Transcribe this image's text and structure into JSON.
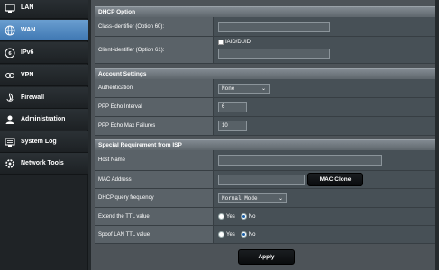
{
  "sidebar": {
    "items": [
      {
        "label": "LAN",
        "icon": "lan-icon"
      },
      {
        "label": "WAN",
        "icon": "wan-globe-icon",
        "active": true
      },
      {
        "label": "IPv6",
        "icon": "ipv6-icon"
      },
      {
        "label": "VPN",
        "icon": "vpn-icon"
      },
      {
        "label": "Firewall",
        "icon": "firewall-icon"
      },
      {
        "label": "Administration",
        "icon": "administration-icon"
      },
      {
        "label": "System Log",
        "icon": "system-log-icon"
      },
      {
        "label": "Network Tools",
        "icon": "network-tools-icon"
      }
    ]
  },
  "dhcp": {
    "title": "DHCP Option",
    "class_label": "Class-identifier (Option 60):",
    "class_value": "",
    "client_label": "Client-identifier (Option 61):",
    "iaid_label": "IAID/DUID",
    "client_value": ""
  },
  "account": {
    "title": "Account Settings",
    "auth_label": "Authentication",
    "auth_value": "None",
    "echo_interval_label": "PPP Echo Interval",
    "echo_interval_value": "6",
    "echo_failures_label": "PPP Echo Max Failures",
    "echo_failures_value": "10"
  },
  "isp": {
    "title": "Special Requirement from ISP",
    "host_label": "Host Name",
    "host_value": "",
    "mac_label": "MAC Address",
    "mac_value": "",
    "mac_clone_label": "MAC Clone",
    "dhcp_freq_label": "DHCP query frequency",
    "dhcp_freq_value": "Normal Mode",
    "ttl_label": "Extend the TTL value",
    "spoof_label": "Spoof LAN TTL value",
    "yes_label": "Yes",
    "no_label": "No"
  },
  "apply_label": "Apply",
  "colors": {
    "active_accent": "#4f8bc5",
    "panel_bg": "#4d5358",
    "sidebar_bg": "#1f2326"
  }
}
